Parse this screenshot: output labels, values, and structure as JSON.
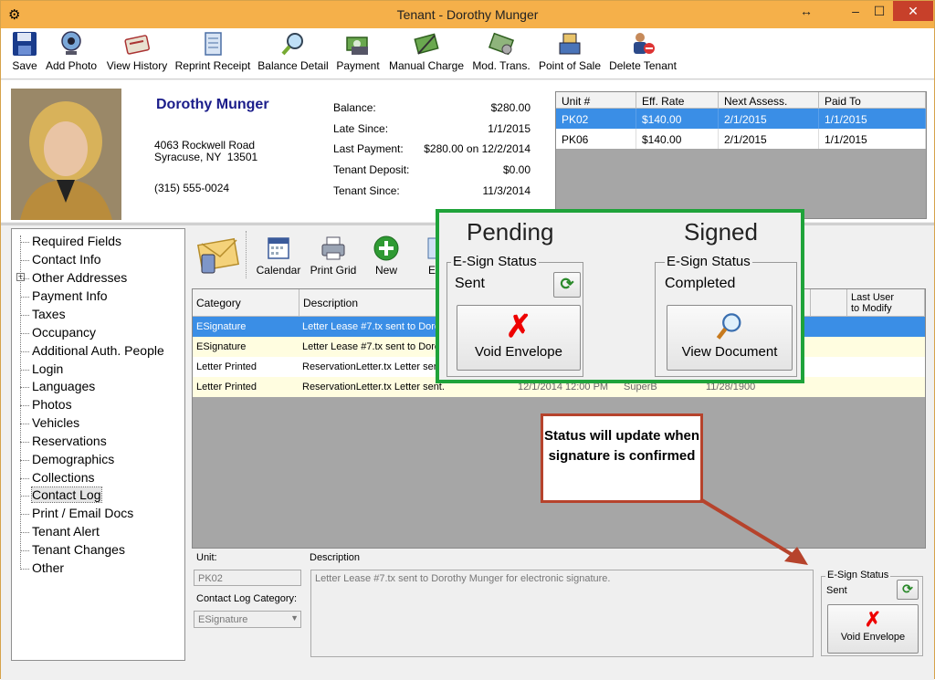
{
  "window": {
    "title": "Tenant - Dorothy Munger",
    "resize_glyph": "↔",
    "minimize": "–",
    "maximize": "☐",
    "close": "✕"
  },
  "toolbar": {
    "items": [
      {
        "label": "Save",
        "icon": "floppy-disk-icon"
      },
      {
        "label": "Add Photo",
        "icon": "webcam-icon"
      },
      {
        "label": "View History",
        "icon": "history-icon"
      },
      {
        "label": "Reprint Receipt",
        "icon": "receipt-icon"
      },
      {
        "label": "Balance Detail",
        "icon": "magnifier-icon"
      },
      {
        "label": "Payment",
        "icon": "money-icon"
      },
      {
        "label": "Manual Charge",
        "icon": "charge-icon"
      },
      {
        "label": "Mod. Trans.",
        "icon": "modify-transaction-icon"
      },
      {
        "label": "Point of Sale",
        "icon": "point-of-sale-icon"
      },
      {
        "label": "Delete Tenant",
        "icon": "delete-tenant-icon"
      }
    ]
  },
  "tenant": {
    "name": "Dorothy Munger",
    "address": "4063 Rockwell Road\nSyracuse, NY  13501",
    "phone": "(315) 555-0024"
  },
  "balance": [
    {
      "label": "Balance:",
      "value": "$280.00"
    },
    {
      "label": "Late Since:",
      "value": "1/1/2015"
    },
    {
      "label": "Last Payment:",
      "value": "$280.00 on 12/2/2014"
    },
    {
      "label": "Tenant Deposit:",
      "value": "$0.00"
    },
    {
      "label": "Tenant Since:",
      "value": "11/3/2014"
    }
  ],
  "units": {
    "headers": [
      "Unit #",
      "Eff. Rate",
      "Next Assess.",
      "Paid To"
    ],
    "rows": [
      [
        "PK02",
        "$140.00",
        "2/1/2015",
        "1/1/2015"
      ],
      [
        "PK06",
        "$140.00",
        "2/1/2015",
        "1/1/2015"
      ]
    ]
  },
  "nav": {
    "items": [
      "Required Fields",
      "Contact Info",
      "Other Addresses",
      "Payment Info",
      "Taxes",
      "Occupancy",
      "Additional Auth. People",
      "Login",
      "Languages",
      "Photos",
      "Vehicles",
      "Reservations",
      "Demographics",
      "Collections",
      "Contact Log",
      "Print / Email Docs",
      "Tenant Alert",
      "Tenant Changes",
      "Other"
    ],
    "expand_glyph": "+"
  },
  "contact_log_toolbar": {
    "items": [
      {
        "label": "Calendar",
        "icon": "calendar-icon"
      },
      {
        "label": "Print Grid",
        "icon": "printer-icon"
      },
      {
        "label": "New",
        "icon": "plus-icon"
      },
      {
        "label": "E",
        "icon": "edit-icon"
      }
    ]
  },
  "log": {
    "headers": {
      "category": "Category",
      "description": "Description",
      "last_user": "Last User\nto Modify"
    },
    "rows": [
      {
        "category": "ESignature",
        "description": "Letter Lease #7.tx sent to Doro",
        "date": "",
        "user": "",
        "modified": ""
      },
      {
        "category": "ESignature",
        "description": "Letter Lease #7.tx sent to Doro",
        "date": "",
        "user": "",
        "modified": ""
      },
      {
        "category": "Letter Printed",
        "description": "ReservationLetter.tx Letter sent",
        "date": "",
        "user": "",
        "modified": ""
      },
      {
        "category": "Letter Printed",
        "description": "ReservationLetter.tx Letter sent.",
        "date": "12/1/2014 12:00 PM",
        "user": "SuperB",
        "modified": "11/28/1900"
      }
    ]
  },
  "detail": {
    "unit_label": "Unit:",
    "unit_value": "PK02",
    "category_label": "Contact Log Category:",
    "category_value": "ESignature",
    "description_label": "Description",
    "description_value": "Letter Lease #7.tx sent to Dorothy Munger for electronic signature."
  },
  "esign": {
    "legend": "E-Sign Status",
    "status": "Sent",
    "void_label": "Void Envelope",
    "void_glyph": "✗",
    "refresh_glyph": "⟳"
  },
  "callout": {
    "pending_title": "Pending",
    "signed_title": "Signed",
    "pending": {
      "legend": "E-Sign Status",
      "status": "Sent",
      "button": "Void Envelope"
    },
    "signed": {
      "legend": "E-Sign Status",
      "status": "Completed",
      "button": "View Document"
    },
    "note": "Status will update when signature is confirmed"
  },
  "colors": {
    "title_bar": "#f5b04a",
    "selected_row": "#3a8ee6",
    "callout_border": "#1fa33a",
    "note_border": "#b6432c",
    "name": "#1b1d8a"
  }
}
